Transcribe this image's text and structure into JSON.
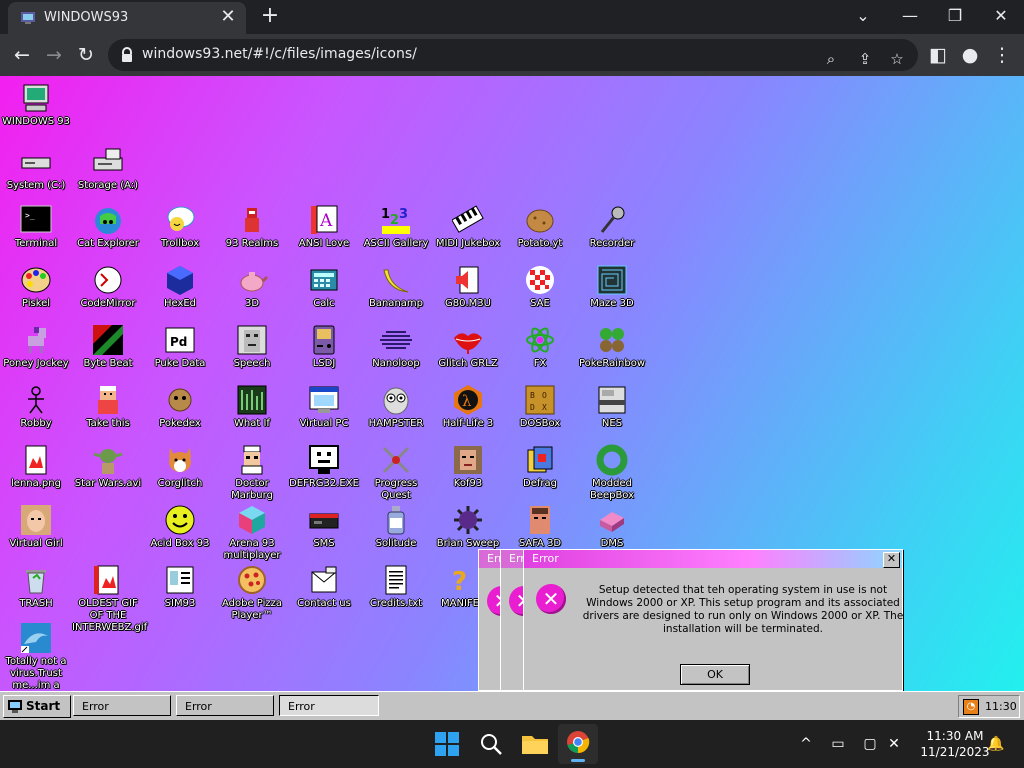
{
  "browser": {
    "tab_title": "WINDOWS93",
    "tab_close": "✕",
    "new_tab": "+",
    "url": "windows93.net/#!/c/files/images/icons/",
    "window_controls": {
      "minimize": "⌄",
      "restore": "—",
      "maximize": "❐",
      "close": "✕"
    }
  },
  "desktop": {
    "icons": [
      {
        "label": "WINDOWS 93",
        "icon": "computer-icon"
      },
      {
        "label": "System (C:)",
        "icon": "drive-icon"
      },
      {
        "label": "Storage (A:)",
        "icon": "floppy-drive-icon"
      },
      {
        "label": "Terminal",
        "icon": "terminal-icon"
      },
      {
        "label": "Cat Explorer",
        "icon": "cat-globe-icon"
      },
      {
        "label": "Trollbox",
        "icon": "chat-bubble-icon"
      },
      {
        "label": "93 Realms",
        "icon": "knight-icon"
      },
      {
        "label": "ANSI Love",
        "icon": "ansi-a-icon"
      },
      {
        "label": "ASCII Gallery",
        "icon": "numbers-icon"
      },
      {
        "label": "MIDI Jukebox",
        "icon": "piano-icon"
      },
      {
        "label": "Potato.yt",
        "icon": "potato-icon"
      },
      {
        "label": "Recorder",
        "icon": "microphone-icon"
      },
      {
        "label": "Piskel",
        "icon": "palette-icon"
      },
      {
        "label": "CodeMirror",
        "icon": "codemirror-icon"
      },
      {
        "label": "HexEd",
        "icon": "hex-cube-icon"
      },
      {
        "label": "3D",
        "icon": "teapot-icon"
      },
      {
        "label": "Calc",
        "icon": "calculator-icon"
      },
      {
        "label": "Bananamp",
        "icon": "banana-icon"
      },
      {
        "label": "G80.M3U",
        "icon": "speaker-icon"
      },
      {
        "label": "SAE",
        "icon": "checker-ball-icon"
      },
      {
        "label": "Maze 3D",
        "icon": "maze-icon"
      },
      {
        "label": "Poney Jockey",
        "icon": "pony-icon"
      },
      {
        "label": "Byte Beat",
        "icon": "bytebeat-icon"
      },
      {
        "label": "Puke Data",
        "icon": "puredata-icon"
      },
      {
        "label": "Speech",
        "icon": "face-icon"
      },
      {
        "label": "LSDJ",
        "icon": "gameboy-icon"
      },
      {
        "label": "Nanoloop",
        "icon": "nanoloop-icon"
      },
      {
        "label": "Glitch GRLZ",
        "icon": "lips-icon"
      },
      {
        "label": "FX",
        "icon": "atom-icon"
      },
      {
        "label": "PokeRainbow",
        "icon": "pokemon-group-icon"
      },
      {
        "label": "Robby",
        "icon": "stick-figure-icon"
      },
      {
        "label": "Take this",
        "icon": "take-this-icon"
      },
      {
        "label": "Pokedex",
        "icon": "pokedex-icon"
      },
      {
        "label": "What If",
        "icon": "what-if-icon"
      },
      {
        "label": "Virtual PC",
        "icon": "virtual-pc-icon"
      },
      {
        "label": "HAMPSTER",
        "icon": "owl-icon"
      },
      {
        "label": "Half-Life 3",
        "icon": "half-life-icon"
      },
      {
        "label": "DOSBox",
        "icon": "dosbox-icon"
      },
      {
        "label": "NES",
        "icon": "nes-icon"
      },
      {
        "label": "lenna.png",
        "icon": "image-file-icon"
      },
      {
        "label": "Star Wars.avi",
        "icon": "yoda-icon"
      },
      {
        "label": "Corglitch",
        "icon": "corgi-icon"
      },
      {
        "label": "Doctor Marburg",
        "icon": "doctor-icon"
      },
      {
        "label": "DEFRG32.EXE",
        "icon": "monitor-face-icon"
      },
      {
        "label": "Progress Quest",
        "icon": "crossed-swords-icon"
      },
      {
        "label": "Kof93",
        "icon": "fighter-face-icon"
      },
      {
        "label": "Defrag",
        "icon": "defrag-icon"
      },
      {
        "label": "Modded BeepBox",
        "icon": "green-ring-icon"
      },
      {
        "label": "Virtual Girl",
        "icon": "virtual-girl-icon"
      },
      {
        "label": "Acid Box 93",
        "icon": "smiley-icon"
      },
      {
        "label": "Arena 93 multiplayer",
        "icon": "cube-icon"
      },
      {
        "label": "SMS",
        "icon": "sms-console-icon"
      },
      {
        "label": "Solitude",
        "icon": "bottle-icon"
      },
      {
        "label": "Brian Sweep",
        "icon": "mine-icon"
      },
      {
        "label": "SAFA 3D",
        "icon": "safa-face-icon"
      },
      {
        "label": "DMS",
        "icon": "dms-icon"
      },
      {
        "label": "TRASH",
        "icon": "trash-icon"
      },
      {
        "label": "OLDEST GIF OF THE INTERWEBZ.gif",
        "icon": "gif-file-icon"
      },
      {
        "label": "SIM93",
        "icon": "sim-card-icon"
      },
      {
        "label": "Adobe Pizza Player™",
        "icon": "pizza-icon"
      },
      {
        "label": "Contact us",
        "icon": "contact-icon"
      },
      {
        "label": "Credits.txt",
        "icon": "text-file-icon"
      },
      {
        "label": "MANIFE",
        "icon": "question-icon"
      },
      {
        "label": "Totally not a virus.Trust me...im a",
        "icon": "dolphin-icon"
      }
    ]
  },
  "dialogs": {
    "back1_title": "Err",
    "back2_title": "Err",
    "main": {
      "title": "Error",
      "close": "✕",
      "message": "Setup detected that teh operating system in use is not Windows 2000 or XP. This setup program and its associated drivers are designed to run only on Windows 2000 or XP. The installation will be terminated.",
      "ok_label": "OK"
    }
  },
  "w93_taskbar": {
    "start_label": "Start",
    "tasks": [
      "Error",
      "Error",
      "Error"
    ],
    "tray_time": "11:30"
  },
  "windows_taskbar": {
    "time": "11:30 AM",
    "date": "11/21/2023"
  },
  "colors": {
    "desktop_gradient_start": "#f31ff0",
    "desktop_gradient_end": "#22f0ee",
    "error_icon": "#e81ed0"
  }
}
